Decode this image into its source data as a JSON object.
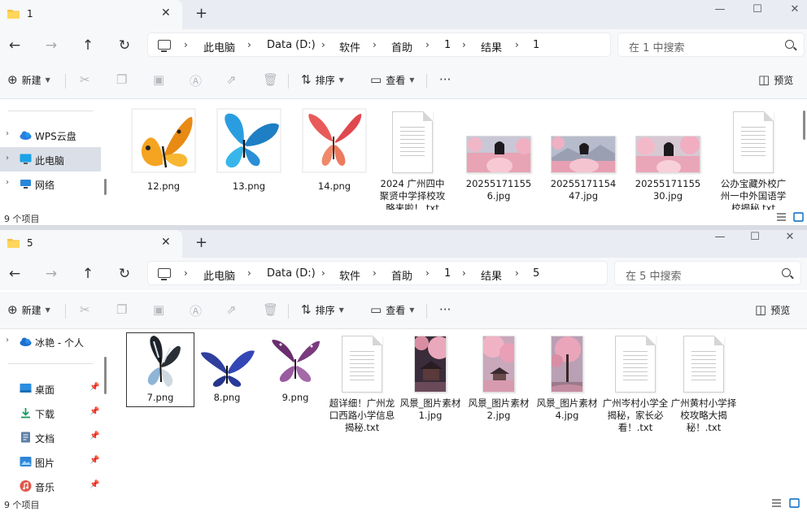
{
  "win1": {
    "tab_title": "1",
    "path": [
      "此电脑",
      "Data (D:)",
      "软件",
      "首助",
      "1",
      "结果",
      "1"
    ],
    "search_placeholder": "在 1 中搜索",
    "status": "9 个项目",
    "sidebar": [
      {
        "label": "WPS云盘",
        "icon": "cloud-icon",
        "selected": false
      },
      {
        "label": "此电脑",
        "icon": "computer-icon",
        "selected": true
      },
      {
        "label": "网络",
        "icon": "network-icon",
        "selected": false
      }
    ],
    "files": [
      {
        "name": "12.png",
        "kind": "butterfly-orange"
      },
      {
        "name": "13.png",
        "kind": "butterfly-blue"
      },
      {
        "name": "14.png",
        "kind": "butterfly-red"
      },
      {
        "name": "2024 广州四中聚贤中学择校攻略来啦！.txt",
        "kind": "doc"
      },
      {
        "name": "202551711556.jpg",
        "kind": "photo-girl"
      },
      {
        "name": "2025517115447.jpg",
        "kind": "photo-girl"
      },
      {
        "name": "2025517115530.jpg",
        "kind": "photo-girl"
      },
      {
        "name": "公办宝藏外校广州一中外国语学校揭秘.txt",
        "kind": "doc"
      }
    ]
  },
  "win2": {
    "tab_title": "5",
    "path": [
      "此电脑",
      "Data (D:)",
      "软件",
      "首助",
      "1",
      "结果",
      "5"
    ],
    "search_placeholder": "在 5 中搜索",
    "status": "9 个项目",
    "sidebar": [
      {
        "label": "冰艳 - 个人",
        "icon": "cloud-icon",
        "pinned": false
      },
      {
        "label": "桌面",
        "icon": "desktop-icon",
        "pinned": true
      },
      {
        "label": "下载",
        "icon": "download-icon",
        "pinned": true
      },
      {
        "label": "文档",
        "icon": "documents-icon",
        "pinned": true
      },
      {
        "label": "图片",
        "icon": "pictures-icon",
        "pinned": true
      },
      {
        "label": "音乐",
        "icon": "music-icon",
        "pinned": true
      }
    ],
    "files": [
      {
        "name": "7.png",
        "kind": "butterfly-bw"
      },
      {
        "name": "8.png",
        "kind": "butterfly-navy"
      },
      {
        "name": "9.png",
        "kind": "butterfly-purple"
      },
      {
        "name": "超详细！广州龙口西路小学信息揭秘.txt",
        "kind": "doc"
      },
      {
        "name": "风景_图片素材1.jpg",
        "kind": "photo-blossom"
      },
      {
        "name": "风景_图片素材2.jpg",
        "kind": "photo-blossom"
      },
      {
        "name": "风景_图片素材4.jpg",
        "kind": "photo-blossom"
      },
      {
        "name": "广州岑村小学全揭秘，家长必看！.txt",
        "kind": "doc"
      },
      {
        "name": "广州黄村小学择校攻略大揭秘！.txt",
        "kind": "doc"
      }
    ]
  },
  "toolbar": {
    "new": "新建",
    "sort": "排序",
    "view": "查看",
    "more": "···",
    "preview": "预览"
  },
  "colors": {
    "accent": "#0067c0",
    "tabbar": "#e9ecf2",
    "selection": "#dbe0e8"
  }
}
